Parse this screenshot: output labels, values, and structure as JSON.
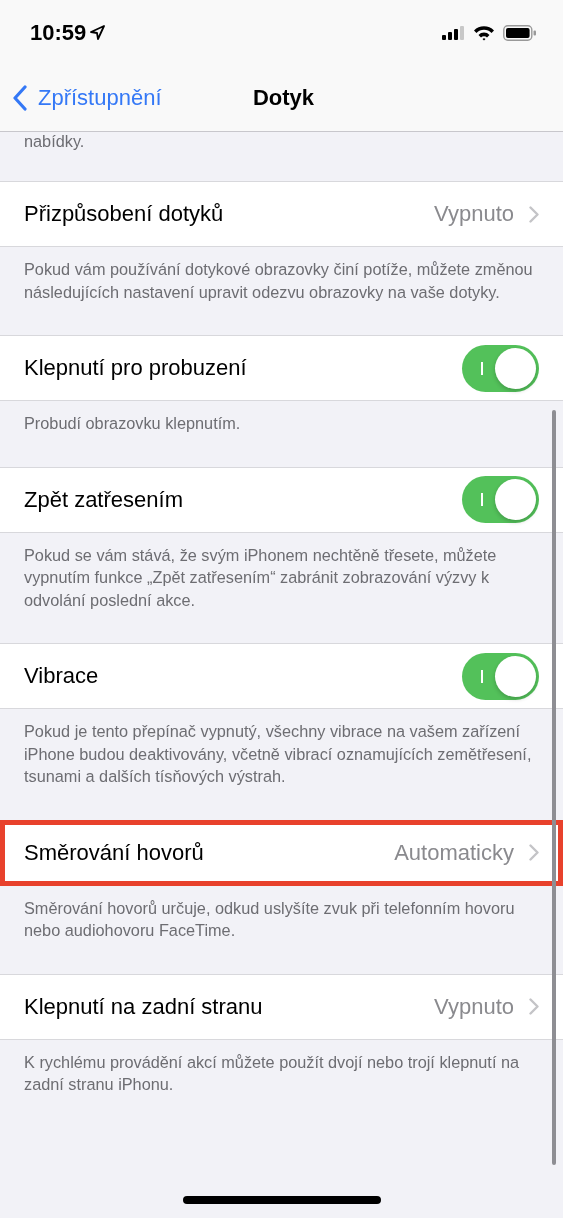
{
  "status_bar": {
    "time": "10:59"
  },
  "nav_bar": {
    "back_label": "Zpřístupnění",
    "title": "Dotyk"
  },
  "top_footer_fragment": "nabídky.",
  "groups": [
    {
      "kind": "link",
      "label": "Přizpůsobení dotyků",
      "value": "Vypnuto",
      "highlighted": false,
      "footer": "Pokud vám používání dotykové obrazovky činí potíže, můžete změnou následujících nastavení upravit odezvu obrazovky na vaše dotyky."
    },
    {
      "kind": "toggle",
      "label": "Klepnutí pro probuzení",
      "on": true,
      "highlighted": false,
      "footer": "Probudí obrazovku klepnutím."
    },
    {
      "kind": "toggle",
      "label": "Zpět zatřesením",
      "on": true,
      "highlighted": false,
      "footer": "Pokud se vám stává, že svým iPhonem nechtěně třesete, můžete vypnutím funkce „Zpět zatřesením“ zabránit zobrazování výzvy k odvolání poslední akce."
    },
    {
      "kind": "toggle",
      "label": "Vibrace",
      "on": true,
      "highlighted": false,
      "footer": "Pokud je tento přepínač vypnutý, všechny vibrace na vašem zařízení iPhone budou deaktivovány, včetně vibrací oznamujících zemětřesení, tsunami a dalších tísňových výstrah."
    },
    {
      "kind": "link",
      "label": "Směrování hovorů",
      "value": "Automaticky",
      "highlighted": true,
      "footer": "Směrování hovorů určuje, odkud uslyšíte zvuk při telefonním hovoru nebo audiohovoru FaceTime."
    },
    {
      "kind": "link",
      "label": "Klepnutí na zadní stranu",
      "value": "Vypnuto",
      "highlighted": false,
      "footer": "K rychlému provádění akcí můžete použít dvojí nebo trojí klepnutí na zadní stranu iPhonu."
    }
  ]
}
